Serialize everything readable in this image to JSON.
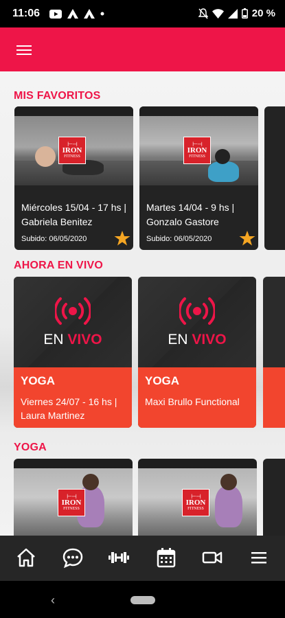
{
  "status_bar": {
    "time": "11:06",
    "battery": "20 %",
    "left_icons": [
      "youtube-icon",
      "app-icon",
      "app-icon",
      "dot-icon"
    ],
    "right_icons": [
      "mute-icon",
      "wifi-icon",
      "signal-icon",
      "battery-icon"
    ]
  },
  "app_bar": {
    "menu_icon": "hamburger-icon",
    "color": "#ee1548"
  },
  "sections": {
    "favorites": {
      "title": "MIS FAVORITOS",
      "cards": [
        {
          "title": "Miércoles 15/04 - 17 hs | Gabriela Benitez",
          "date": "Subido: 06/05/2020",
          "favorite": true
        },
        {
          "title": "Martes 14/04 - 9 hs | Gonzalo Gastore",
          "date": "Subido: 06/05/2020",
          "favorite": true
        }
      ]
    },
    "live": {
      "title": "AHORA EN VIVO",
      "cards": [
        {
          "label_en": "EN",
          "label_vivo": "VIVO",
          "category": "YOGA",
          "description": "Viernes 24/07 - 16 hs | Laura Martinez"
        },
        {
          "label_en": "EN",
          "label_vivo": "VIVO",
          "category": "YOGA",
          "description": "Maxi Brullo Functional"
        }
      ]
    },
    "yoga": {
      "title": "YOGA"
    }
  },
  "logo": {
    "line1": "IRON",
    "line2": "FITNESS"
  },
  "bottom_nav": {
    "items": [
      "home-icon",
      "chat-icon",
      "dumbbell-icon",
      "calendar-icon",
      "video-icon",
      "menu-icon"
    ]
  },
  "colors": {
    "brand": "#ee1548",
    "live_orange": "#f2452e",
    "star": "#f5a623",
    "nav_bg": "#262626"
  }
}
